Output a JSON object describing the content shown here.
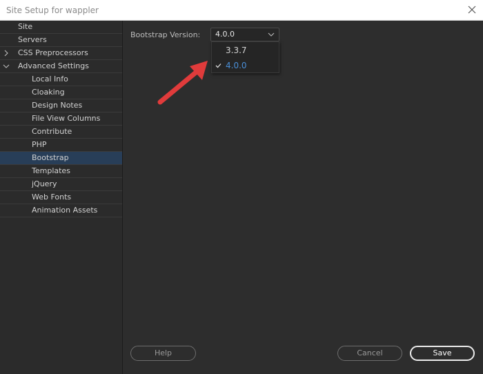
{
  "window": {
    "title": "Site Setup for wappler"
  },
  "sidebar": {
    "items": [
      {
        "label": "Site"
      },
      {
        "label": "Servers"
      },
      {
        "label": "CSS Preprocessors"
      },
      {
        "label": "Advanced Settings"
      },
      {
        "label": "Local Info"
      },
      {
        "label": "Cloaking"
      },
      {
        "label": "Design Notes"
      },
      {
        "label": "File View Columns"
      },
      {
        "label": "Contribute"
      },
      {
        "label": "PHP"
      },
      {
        "label": "Bootstrap",
        "selected": true
      },
      {
        "label": "Templates"
      },
      {
        "label": "jQuery"
      },
      {
        "label": "Web Fonts"
      },
      {
        "label": "Animation Assets"
      }
    ]
  },
  "main": {
    "bootstrap_label": "Bootstrap Version:",
    "bootstrap_value": "4.0.0",
    "options": [
      {
        "label": "3.3.7",
        "checked": false
      },
      {
        "label": "4.0.0",
        "checked": true
      }
    ]
  },
  "buttons": {
    "help": "Help",
    "cancel": "Cancel",
    "save": "Save"
  },
  "colors": {
    "background": "#2d2d2d",
    "selection": "#283e58",
    "option_active": "#4a8fd8",
    "annotation_arrow": "#e03b3b"
  },
  "icons": [
    "close-icon",
    "chevron-right-icon",
    "chevron-down-icon",
    "caret-down-icon",
    "check-icon",
    "red-arrow-annotation"
  ]
}
